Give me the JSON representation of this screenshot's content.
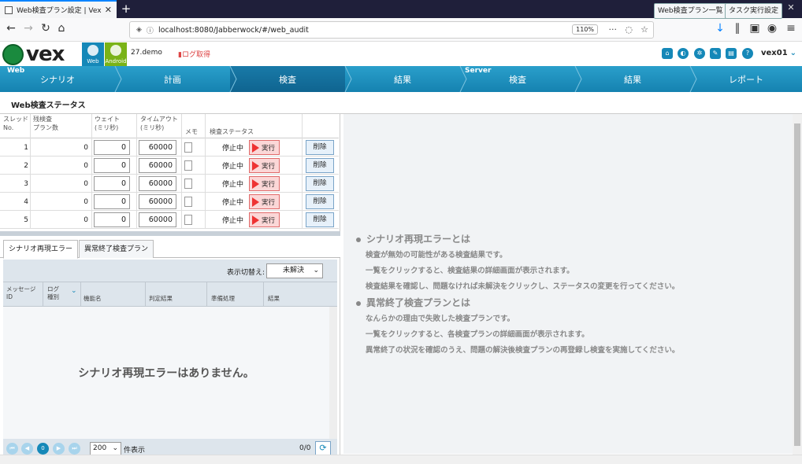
{
  "browser": {
    "tab_title": "Web検査プラン設定 | Vex",
    "tab_close": "✕",
    "new_tab": "+",
    "url": "localhost:8080/Jabberwock/#/web_audit",
    "zoom": "110%",
    "win_min": "—",
    "win_max": "❐",
    "win_close": "✕"
  },
  "app": {
    "logo_text": "vex",
    "web_label": "Web",
    "android_label": "Android",
    "project": "27.demo",
    "log_button": "ログ取得",
    "user": "vex01",
    "user_chev": "⌄"
  },
  "steps": {
    "web_group": "Web",
    "server_group": "Server",
    "items": [
      "シナリオ",
      "計画",
      "検査",
      "結果",
      "検査",
      "結果",
      "レポート"
    ]
  },
  "toolbar": {
    "title": "Web検査ステータス",
    "plan_list_button": "Web検査プラン一覧",
    "task_settings_button": "タスク実行設定"
  },
  "thread_table": {
    "headers": {
      "thread": [
        "スレッド",
        "No."
      ],
      "remaining": [
        "残検査",
        "プラン数"
      ],
      "wait": [
        "ウェイト",
        "(ミリ秒)"
      ],
      "timeout": [
        "タイムアウト",
        "(ミリ秒)"
      ],
      "memo": "メモ",
      "status": "検査ステータス"
    },
    "run_label": "実行",
    "delete_label": "削除",
    "rows": [
      {
        "no": "1",
        "remaining": "0",
        "wait": "0",
        "timeout": "60000",
        "status": "停止中"
      },
      {
        "no": "2",
        "remaining": "0",
        "wait": "0",
        "timeout": "60000",
        "status": "停止中"
      },
      {
        "no": "3",
        "remaining": "0",
        "wait": "0",
        "timeout": "60000",
        "status": "停止中"
      },
      {
        "no": "4",
        "remaining": "0",
        "wait": "0",
        "timeout": "60000",
        "status": "停止中"
      },
      {
        "no": "5",
        "remaining": "0",
        "wait": "0",
        "timeout": "60000",
        "status": "停止中"
      }
    ]
  },
  "error_panel": {
    "tabs": [
      "シナリオ再現エラー",
      "異常終了検査プラン"
    ],
    "filter_label": "表示切替え:",
    "filter_value": "未解決",
    "columns": {
      "msg_id": [
        "メッセージ",
        "ID"
      ],
      "log_type": [
        "ログ",
        "種別"
      ],
      "function": "機能名",
      "judgement": "判定結果",
      "prep": "準備処理",
      "result": "結果"
    },
    "empty_message": "シナリオ再現エラーはありません。",
    "pager": {
      "current_page": "0",
      "page_size": "200",
      "page_size_label": "件表示",
      "count": "0/0"
    }
  },
  "help": {
    "section1_title": "シナリオ再現エラーとは",
    "section1_lines": [
      "検査が無効の可能性がある検査結果です。",
      "一覧をクリックすると、検査結果の詳細画面が表示されます。",
      "検査結果を確認し、問題なければ未解決をクリックし、ステータスの変更を行ってください。"
    ],
    "section2_title": "異常終了検査プランとは",
    "section2_lines": [
      "なんらかの理由で失敗した検査プランです。",
      "一覧をクリックすると、各検査プランの詳細画面が表示されます。",
      "異常終了の状況を確認のうえ、問題の解決後検査プランの再登録し検査を実施してください。"
    ]
  },
  "colors": {
    "brand_blue": "#1588b8",
    "android_green": "#7ab317",
    "run_red": "#e33333"
  }
}
